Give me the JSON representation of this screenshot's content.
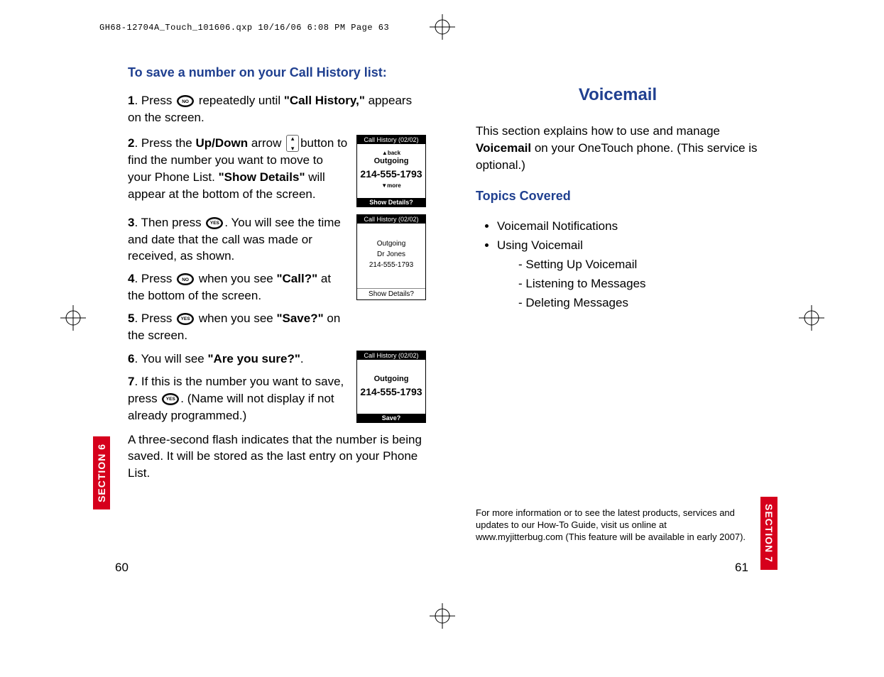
{
  "header_line": "GH68-12704A_Touch_101606.qxp  10/16/06  6:08 PM  Page 63",
  "left": {
    "heading": "To save a number on your Call History list:",
    "step1_a": "1",
    "step1_b": ".  Press ",
    "step1_c": " repeatedly until ",
    "step1_d": "\"Call History,\"",
    "step1_e": "appears on the screen.",
    "btn_no": "NO",
    "step2_a": "2",
    "step2_b": ".  Press the ",
    "step2_c": "Up/Down",
    "step2_d": " arrow",
    "step2_e": "button to find the number you want to move to your Phone List. ",
    "step2_f": "\"Show Details\"",
    "step2_g": " will appear at the bottom of the screen.",
    "screen1": {
      "header": "Call History (02/02)",
      "back": "▲back",
      "title": "Outgoing",
      "number": "214-555-1793",
      "more": "▼more",
      "footer": "Show Details?"
    },
    "step3_a": "3",
    "step3_b": ".  Then press ",
    "step3_c": ". You will see the time and date that the call was made or received, as shown.",
    "btn_yes": "YES",
    "screen2": {
      "header": "Call History (02/02)",
      "l1": "Outgoing",
      "l2": "Dr Jones",
      "l3": "214-555-1793",
      "footer": "Show Details?"
    },
    "step4_a": "4",
    "step4_b": ".  Press ",
    "step4_c": " when you see ",
    "step4_d": "\"Call?\"",
    "step4_e": "at the bottom of the screen.",
    "step5_a": "5",
    "step5_b": ".  Press ",
    "step5_c": " when you see ",
    "step5_d": "\"Save?\"",
    "step5_e": " on the screen.",
    "step6_a": "6",
    "step6_b": ".  You will see ",
    "step6_c": "\"Are you sure?\"",
    "step6_d": ".",
    "screen3": {
      "header": "Call History (02/02)",
      "title": "Outgoing",
      "number": "214-555-1793",
      "footer": "Save?"
    },
    "step7_a": "7",
    "step7_b": ".  If this is the  number you want to save, press ",
    "step7_c": ". (Name will not display if not already programmed.)",
    "closing": "A three-second flash indicates that the number is being saved. It will be stored as the last entry on your Phone List.",
    "page_num": "60",
    "section_tab": "SECTION 6"
  },
  "right": {
    "chapter_title": "Voicemail",
    "intro_a": "This section explains how to use and manage ",
    "intro_b": "Voicemail",
    "intro_c": " on your OneTouch phone. (This service is optional.)",
    "topics_heading": "Topics Covered",
    "topics": {
      "t1": "Voicemail Notifications",
      "t2": "Using Voicemail",
      "s1": "Setting Up Voicemail",
      "s2": "Listening to Messages",
      "s3": "Deleting Messages"
    },
    "footnote": "For more information or to see the latest products, services and updates to our How-To Guide, visit us online at www.myjitterbug.com (This feature will be available in early 2007).",
    "page_num": "61",
    "section_tab": "SECTION 7"
  }
}
